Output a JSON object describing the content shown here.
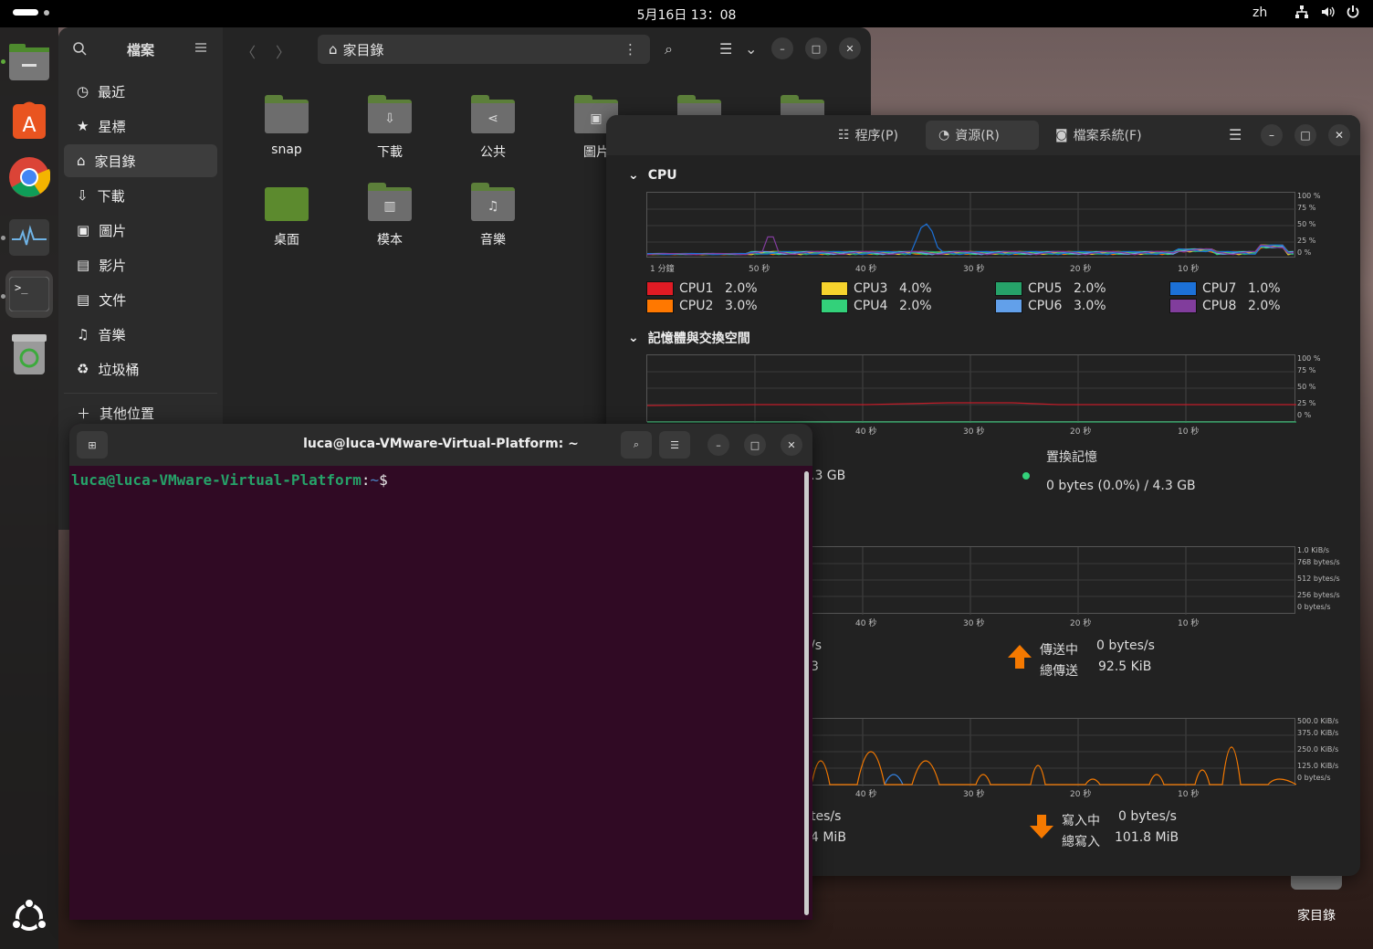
{
  "topbar": {
    "clock": "5月16日 13：08",
    "lang": "zh"
  },
  "dock": {
    "items": [
      "files-icon",
      "app-center-icon",
      "chrome-icon",
      "system-monitor-icon",
      "terminal-icon",
      "trash-icon"
    ]
  },
  "files": {
    "sidebar_title": "檔案",
    "sidebar": [
      {
        "icon": "clock-icon",
        "label": "最近"
      },
      {
        "icon": "star-icon",
        "label": "星標"
      },
      {
        "icon": "home-icon",
        "label": "家目錄"
      },
      {
        "icon": "download-icon",
        "label": "下載"
      },
      {
        "icon": "image-icon",
        "label": "圖片"
      },
      {
        "icon": "film-icon",
        "label": "影片"
      },
      {
        "icon": "document-icon",
        "label": "文件"
      },
      {
        "icon": "music-icon",
        "label": "音樂"
      },
      {
        "icon": "trash-icon",
        "label": "垃圾桶"
      }
    ],
    "other_places": "其他位置",
    "path": "家目錄",
    "folders": [
      {
        "label": "snap",
        "glyph": ""
      },
      {
        "label": "下載",
        "glyph": "⇩"
      },
      {
        "label": "公共",
        "glyph": "⋖"
      },
      {
        "label": "圖片",
        "glyph": "▣"
      },
      {
        "label": "桌面",
        "glyph": ""
      },
      {
        "label": "模本",
        "glyph": "▥"
      },
      {
        "label": "音樂",
        "glyph": "♫"
      }
    ]
  },
  "sysmon": {
    "tabs": [
      "程序(P)",
      "資源(R)",
      "檔案系統(F)"
    ],
    "cpu_title": "CPU",
    "mem_title": "記憶體與交換空間",
    "cpu_ylabels": [
      "100 %",
      "75 %",
      "50 %",
      "25 %",
      "0 %"
    ],
    "cpu_xlabels": [
      "1 分鐘",
      "50 秒",
      "40 秒",
      "30 秒",
      "20 秒",
      "10 秒"
    ],
    "time_xlabels": [
      "40 秒",
      "30 秒",
      "20 秒",
      "10 秒"
    ],
    "cpus": [
      {
        "name": "CPU1",
        "value": "2.0%",
        "color": "#e01b24"
      },
      {
        "name": "CPU2",
        "value": "3.0%",
        "color": "#ff7800"
      },
      {
        "name": "CPU3",
        "value": "4.0%",
        "color": "#f6d32d"
      },
      {
        "name": "CPU4",
        "value": "2.0%",
        "color": "#33d17a"
      },
      {
        "name": "CPU5",
        "value": "2.0%",
        "color": "#26a269"
      },
      {
        "name": "CPU6",
        "value": "3.0%",
        "color": "#62a0ea"
      },
      {
        "name": "CPU7",
        "value": "1.0%",
        "color": "#1c71d8"
      },
      {
        "name": "CPU8",
        "value": "2.0%",
        "color": "#813d9c"
      }
    ],
    "mem_partial": ".3 GB",
    "swap_label": "置換記憶",
    "swap_value": "0 bytes (0.0%) / 4.3 GB",
    "net_ylabels": [
      "1.0 KiB/s",
      "768 bytes/s",
      "512 bytes/s",
      "256 bytes/s",
      "0 bytes/s"
    ],
    "net_partial1": "/s",
    "net_partial2": "3",
    "send_label": "傳送中",
    "send_value": "0 bytes/s",
    "total_send_label": "總傳送",
    "total_send_value": "92.5 KiB",
    "disk_ylabels": [
      "500.0 KiB/s",
      "375.0 KiB/s",
      "250.0 KiB/s",
      "125.0 KiB/s",
      "0 bytes/s"
    ],
    "disk_partial1": "tes/s",
    "disk_partial2": "4 MiB",
    "write_label": "寫入中",
    "write_value": "0 bytes/s",
    "total_write_label": "總寫入",
    "total_write_value": "101.8 MiB"
  },
  "terminal": {
    "title": "luca@luca-VMware-Virtual-Platform: ~",
    "user": "luca@luca-VMware-Virtual-Platform",
    "colon": ":",
    "path": "~",
    "prompt": "$"
  },
  "desktop": {
    "icon_label": "家目錄"
  }
}
